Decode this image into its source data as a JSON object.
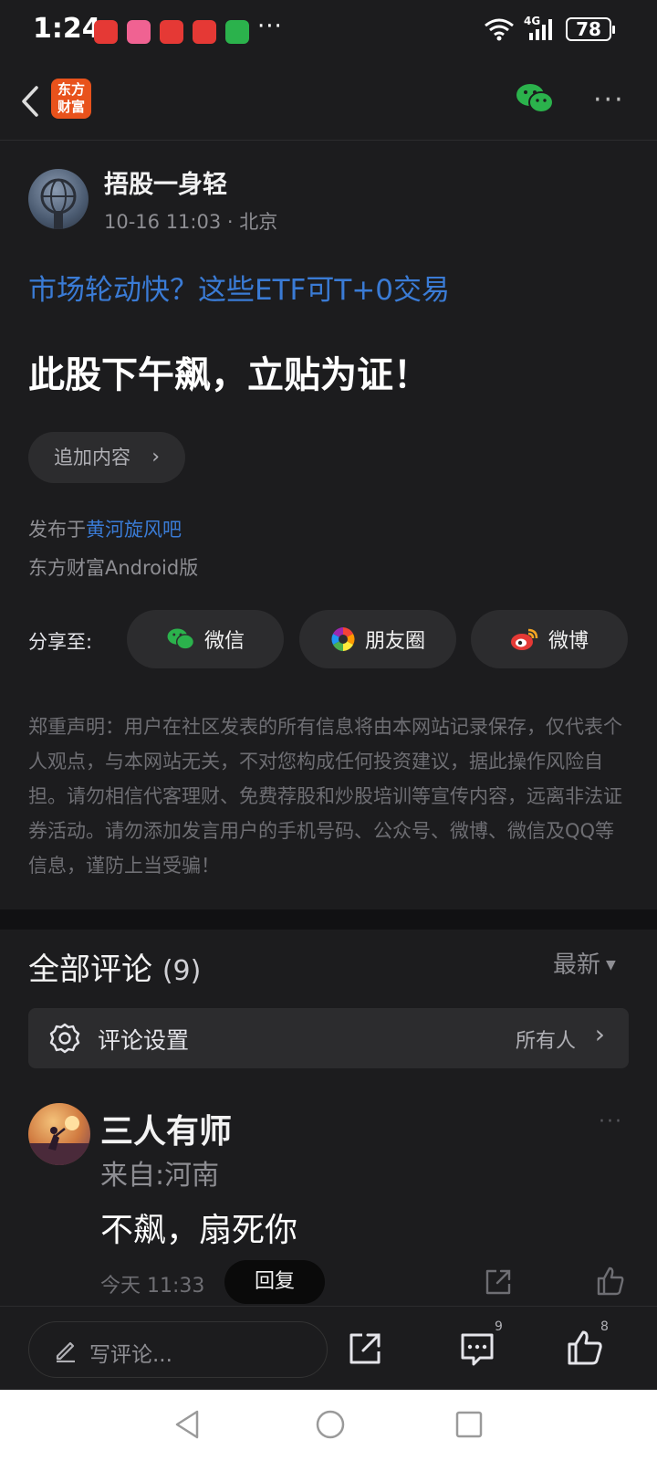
{
  "status_bar": {
    "time": "1:24",
    "network": "4G",
    "battery": "78",
    "more": "···"
  },
  "header": {
    "logo_text": "东方财富",
    "more": "···"
  },
  "post": {
    "author": "捂股一身轻",
    "meta": "10-16 11:03 · 北京",
    "promo_link": "市场轮动快？这些ETF可T+0交易",
    "title": "此股下午飙，立贴为证！",
    "add_content_label": "追加内容",
    "published_prefix": "发布于",
    "forum": "黄河旋风吧",
    "client": "东方财富Android版"
  },
  "share": {
    "label": "分享至:",
    "wechat": "微信",
    "moments": "朋友圈",
    "weibo": "微博"
  },
  "disclaimer": "郑重声明：用户在社区发表的所有信息将由本网站记录保存，仅代表个人观点，与本网站无关，不对您构成任何投资建议，据此操作风险自担。请勿相信代客理财、免费荐股和炒股培训等宣传内容，远离非法证券活动。请勿添加发言用户的手机号码、公众号、微博、微信及QQ等信息，谨防上当受骗！",
  "comments": {
    "title": "全部评论",
    "count": "(9)",
    "sort": "最新",
    "settings_label": "评论设置",
    "settings_value": "所有人",
    "items": [
      {
        "name": "三人有师",
        "location": "来自:河南",
        "text": "不飙，扇死你",
        "time": "今天 11:33",
        "reply_label": "回复",
        "more": "···"
      }
    ]
  },
  "bottom_bar": {
    "write_placeholder": "写评论...",
    "comment_count": "9",
    "like_count": "8"
  },
  "colors": {
    "background": "#1c1c1e",
    "link_blue": "#3a7bd5",
    "brand_orange": "#e8521c",
    "wechat_green": "#2bb24c"
  }
}
